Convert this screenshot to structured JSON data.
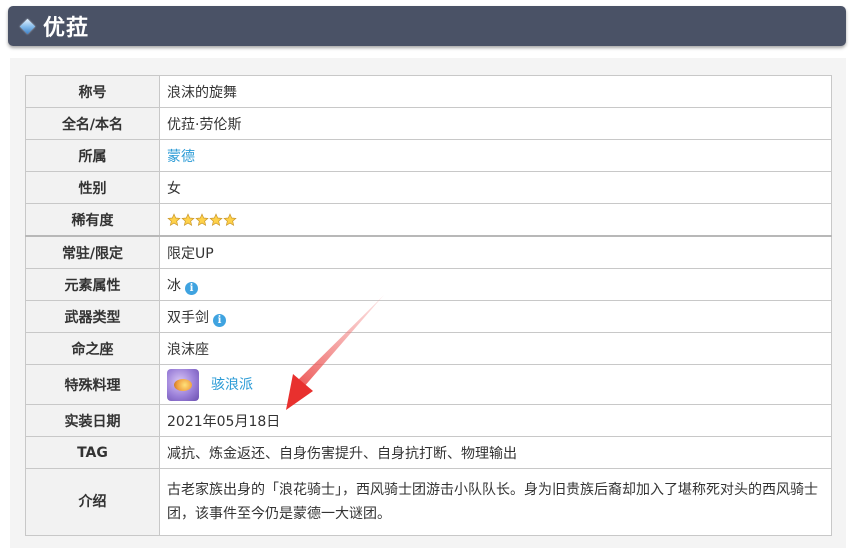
{
  "header": {
    "title": "优菈"
  },
  "rows": [
    {
      "key": "称号",
      "value": "浪沫的旋舞"
    },
    {
      "key": "全名/本名",
      "value": "优菈·劳伦斯"
    },
    {
      "key": "所属",
      "value": "蒙德"
    },
    {
      "key": "性别",
      "value": "女"
    },
    {
      "key": "稀有度",
      "stars": 5
    },
    {
      "key": "常驻/限定",
      "value": "限定UP"
    },
    {
      "key": "元素属性",
      "value": "冰"
    },
    {
      "key": "武器类型",
      "value": "双手剑"
    },
    {
      "key": "命之座",
      "value": "浪沫座"
    },
    {
      "key": "特殊料理",
      "value": "骇浪派"
    },
    {
      "key": "实装日期",
      "value": "2021年05月18日"
    },
    {
      "key": "TAG",
      "value": "减抗、炼金返还、自身伤害提升、自身抗打断、物理输出"
    },
    {
      "key": "介绍",
      "value": "古老家族出身的「浪花骑士」，西风骑士团游击小队队长。身为旧贵族后裔却加入了堪称死对头的西风骑士团，该事件至今仍是蒙德一大谜团。"
    }
  ],
  "colors": {
    "title_bar": "#4a5266",
    "link": "#2b9bd6",
    "arrow": "#e8302e",
    "key_bg": "#f2f2f2"
  }
}
